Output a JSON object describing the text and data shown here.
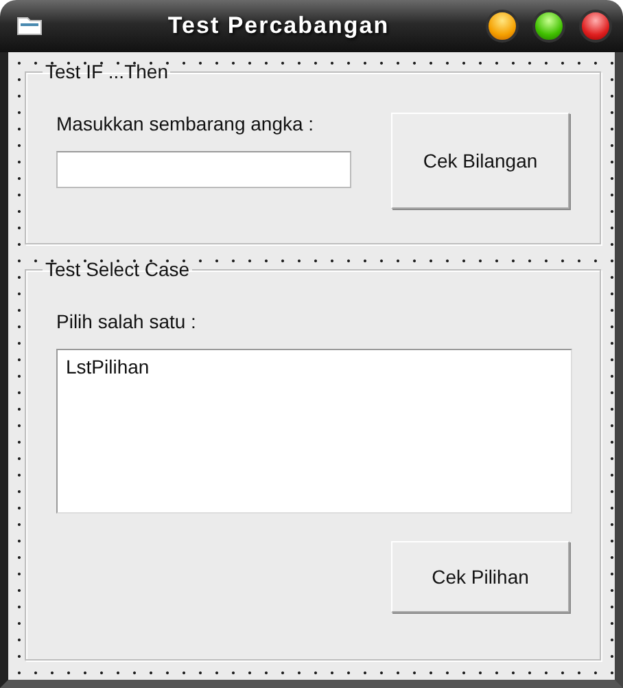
{
  "window": {
    "title": "Test Percabangan"
  },
  "groups": [
    {
      "kind": "input",
      "title": "Test IF ...Then",
      "label": "Masukkan sembarang angka :",
      "button": "Cek Bilangan"
    },
    {
      "kind": "list",
      "title": "Test Select Case",
      "label": "Pilih salah satu :",
      "items": [
        "LstPilihan"
      ],
      "button": "Cek Pilihan"
    }
  ]
}
